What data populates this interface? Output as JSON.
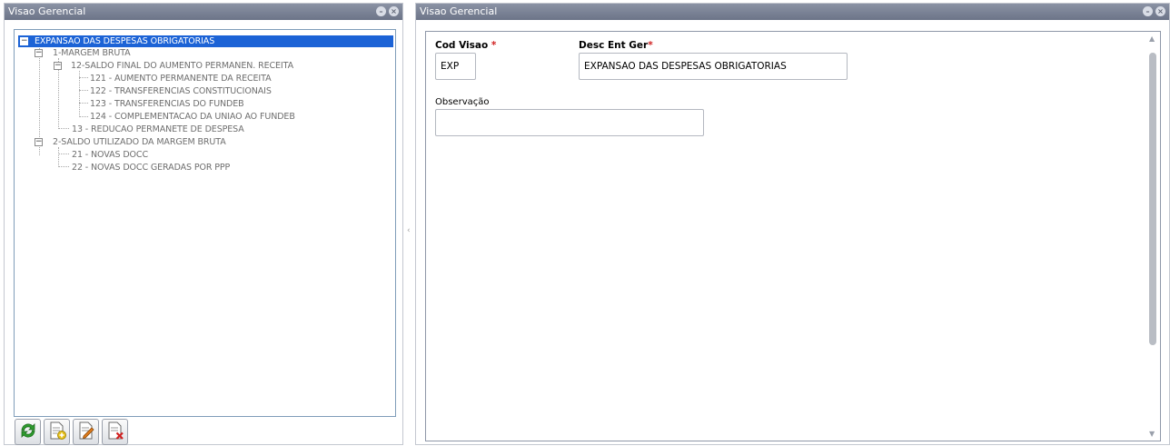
{
  "left_panel": {
    "title": "Visao Gerencial"
  },
  "right_panel": {
    "title": "Visao Gerencial"
  },
  "tree": {
    "items": [
      {
        "label": "EXPANSAO DAS DESPESAS OBRIGATORIAS",
        "selected": true,
        "expandable": true
      },
      {
        "label": "1-MARGEM BRUTA",
        "expandable": true
      },
      {
        "label": "12-SALDO FINAL DO AUMENTO PERMANEN. RECEITA",
        "expandable": true
      },
      {
        "label": "121 - AUMENTO PERMANENTE DA RECEITA"
      },
      {
        "label": "122 - TRANSFERENCIAS CONSTITUCIONAIS"
      },
      {
        "label": "123 - TRANSFERENCIAS DO FUNDEB"
      },
      {
        "label": "124 - COMPLEMENTACAO DA UNIAO AO FUNDEB"
      },
      {
        "label": "13 - REDUCAO PERMANETE DE DESPESA"
      },
      {
        "label": "2-SALDO UTILIZADO DA MARGEM BRUTA",
        "expandable": true
      },
      {
        "label": "21 - NOVAS DOCC"
      },
      {
        "label": "22 - NOVAS DOCC GERADAS POR PPP"
      }
    ]
  },
  "toolbar": {
    "buttons": [
      {
        "name": "refresh",
        "icon": "refresh-icon"
      },
      {
        "name": "add",
        "icon": "add-document-icon"
      },
      {
        "name": "edit",
        "icon": "edit-document-icon"
      },
      {
        "name": "delete",
        "icon": "delete-document-icon"
      }
    ]
  },
  "form": {
    "cod_visao": {
      "label": "Cod Visao",
      "required_mark": "*",
      "value": "EXP"
    },
    "desc_ent_ger": {
      "label": "Desc Ent Ger",
      "required_mark": "*",
      "value": "EXPANSAO DAS DESPESAS OBRIGATORIAS"
    },
    "observacao": {
      "label": "Observação",
      "value": ""
    }
  },
  "colors": {
    "titlebar": "#6c7488",
    "selection": "#1c63d6",
    "required": "#d02020"
  }
}
